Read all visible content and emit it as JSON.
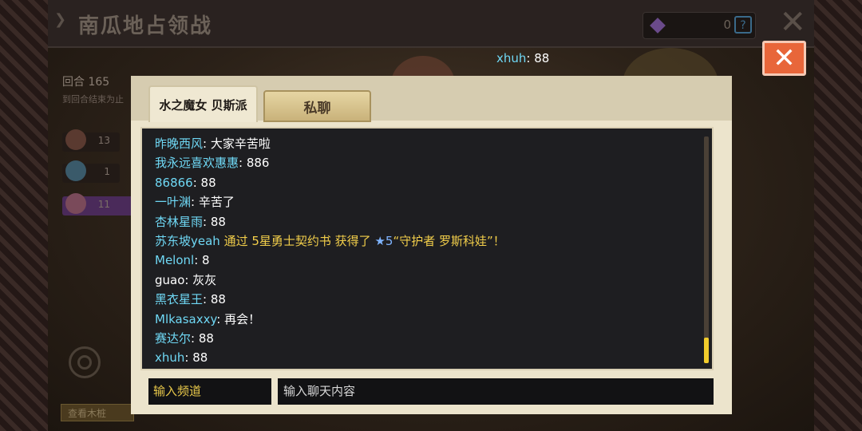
{
  "title_bar": {
    "title": "南瓜地占领战",
    "resource_value": "0",
    "help_label": "?"
  },
  "side_panel": {
    "round": "回合 165",
    "round_sub": "到回合结束为止",
    "players": [
      {
        "count": "13"
      },
      {
        "count": "1"
      },
      {
        "count": "11"
      }
    ],
    "bottom_button": "查看木桩"
  },
  "top_chat": {
    "name": "xhuh",
    "message": ": 88"
  },
  "chat_panel": {
    "tab_guild": "水之魔女 贝斯派",
    "tab_private": "私聊",
    "lines": [
      {
        "name": "昨晚西风",
        "text": ": 大家辛苦啦"
      },
      {
        "name": "我永远喜欢惠惠",
        "text": ": 886"
      },
      {
        "name": "86866",
        "text": ": 88"
      },
      {
        "name": "一叶渊",
        "text": ": 辛苦了"
      },
      {
        "name": "杏林星雨",
        "text": ": 88"
      },
      {
        "name": "Melonl",
        "text": ": 8"
      },
      {
        "name": "guao",
        "text": ": 灰灰"
      },
      {
        "name": "黑衣星王",
        "text": ": 88"
      },
      {
        "name": "Mlkasaxxy",
        "text": ": 再会！"
      },
      {
        "name": "赛达尔",
        "text": ": 88"
      },
      {
        "name": "xhuh",
        "text": ": 88"
      }
    ],
    "system_line": {
      "name": "苏东坡yeah",
      "text1": " 通过 5星勇士契约书 获得了 ",
      "star": "★5",
      "text2": "“守护者 罗斯科娃”！"
    },
    "channel_input": "输入频道",
    "chat_input_placeholder": "输入聊天内容"
  },
  "colors": {
    "name": "#6fd8f5",
    "system": "#f2ce4a",
    "close_button": "#e8663a"
  }
}
